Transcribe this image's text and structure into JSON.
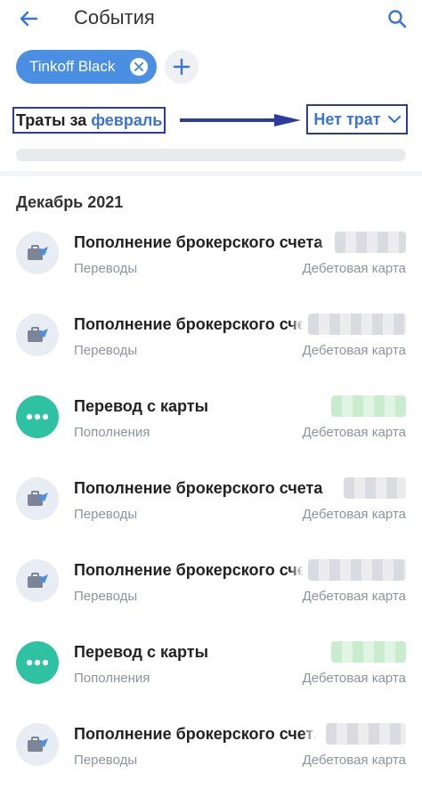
{
  "header": {
    "title": "События"
  },
  "filter": {
    "chip_label": "Tinkoff Black"
  },
  "summary": {
    "spend_prefix": "Траты за",
    "month": "февраль",
    "no_spend": "Нет трат",
    "progress": 0
  },
  "section": {
    "title": "Декабрь 2021"
  },
  "transactions": [
    {
      "name": "Пополнение брокерского счета",
      "category": "Переводы",
      "card": "Дебетовая карта"
    },
    {
      "name": "Пополнение брокерского счета",
      "category": "Переводы",
      "card": "Дебетовая карта"
    },
    {
      "name": "Перевод с карты",
      "category": "Пополнения",
      "card": "Дебетовая карта"
    },
    {
      "name": "Пополнение брокерского счета",
      "category": "Переводы",
      "card": "Дебетовая карта"
    },
    {
      "name": "Пополнение брокерского счета",
      "category": "Переводы",
      "card": "Дебетовая карта"
    },
    {
      "name": "Перевод с карты",
      "category": "Пополнения",
      "card": "Дебетовая карта"
    },
    {
      "name": "Пополнение брокерского счета",
      "category": "Переводы",
      "card": "Дебетовая карта"
    }
  ],
  "colors": {
    "accent": "#3a74d6",
    "chip": "#4a8fe2",
    "topup_icon": "#2ec2a2",
    "annotation": "#2c3b9e"
  },
  "icons": {
    "back": "arrow-left-icon",
    "search": "search-icon",
    "chip_close": "close-icon",
    "add": "plus-icon",
    "transfer": "briefcase-arrow-icon",
    "topup": "dots-icon",
    "dropdown": "chevron-down-icon"
  }
}
